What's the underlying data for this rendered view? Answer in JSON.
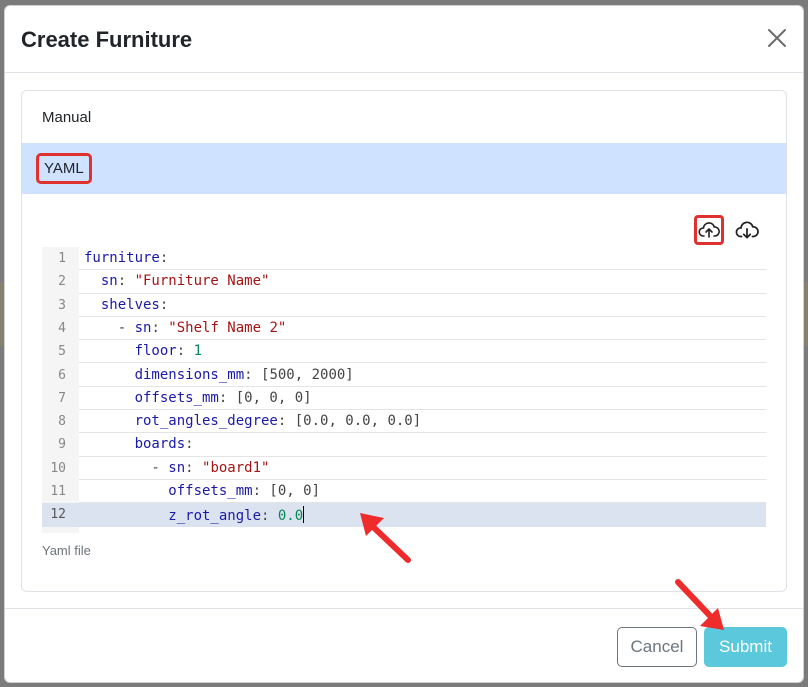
{
  "modal": {
    "title": "Create Furniture"
  },
  "tabs": [
    {
      "label": "Manual"
    },
    {
      "label": "YAML"
    }
  ],
  "editor": {
    "lines": [
      [
        {
          "t": "furniture",
          "c": "k"
        },
        {
          "t": ":",
          "c": "p"
        }
      ],
      [
        {
          "t": "  sn",
          "c": "k"
        },
        {
          "t": ": ",
          "c": "p"
        },
        {
          "t": "\"Furniture Name\"",
          "c": "s"
        }
      ],
      [
        {
          "t": "  shelves",
          "c": "k"
        },
        {
          "t": ":",
          "c": "p"
        }
      ],
      [
        {
          "t": "    - ",
          "c": "p"
        },
        {
          "t": "sn",
          "c": "k"
        },
        {
          "t": ": ",
          "c": "p"
        },
        {
          "t": "\"Shelf Name 2\"",
          "c": "s"
        }
      ],
      [
        {
          "t": "      floor",
          "c": "k"
        },
        {
          "t": ": ",
          "c": "p"
        },
        {
          "t": "1",
          "c": "n"
        }
      ],
      [
        {
          "t": "      dimensions_mm",
          "c": "k"
        },
        {
          "t": ": [500, 2000]",
          "c": "p"
        }
      ],
      [
        {
          "t": "      offsets_mm",
          "c": "k"
        },
        {
          "t": ": [0, 0, 0]",
          "c": "p"
        }
      ],
      [
        {
          "t": "      rot_angles_degree",
          "c": "k"
        },
        {
          "t": ": [0.0, 0.0, 0.0]",
          "c": "p"
        }
      ],
      [
        {
          "t": "      boards",
          "c": "k"
        },
        {
          "t": ":",
          "c": "p"
        }
      ],
      [
        {
          "t": "        - ",
          "c": "p"
        },
        {
          "t": "sn",
          "c": "k"
        },
        {
          "t": ": ",
          "c": "p"
        },
        {
          "t": "\"board1\"",
          "c": "s"
        }
      ],
      [
        {
          "t": "          offsets_mm",
          "c": "k"
        },
        {
          "t": ": [0, 0]",
          "c": "p"
        }
      ],
      [
        {
          "t": "          z_rot_angle",
          "c": "k"
        },
        {
          "t": ": ",
          "c": "p"
        },
        {
          "t": "0.0",
          "c": "n"
        }
      ]
    ],
    "active_line": 12,
    "hint": "Yaml file"
  },
  "toolbar": {
    "upload_icon": "cloud-upload-icon",
    "download_icon": "cloud-download-icon"
  },
  "footer": {
    "cancel_label": "Cancel",
    "submit_label": "Submit"
  },
  "colors": {
    "tab_active_bg": "#cfe2ff",
    "highlight_red": "#e03131",
    "submit_bg": "#5bc8dc"
  }
}
